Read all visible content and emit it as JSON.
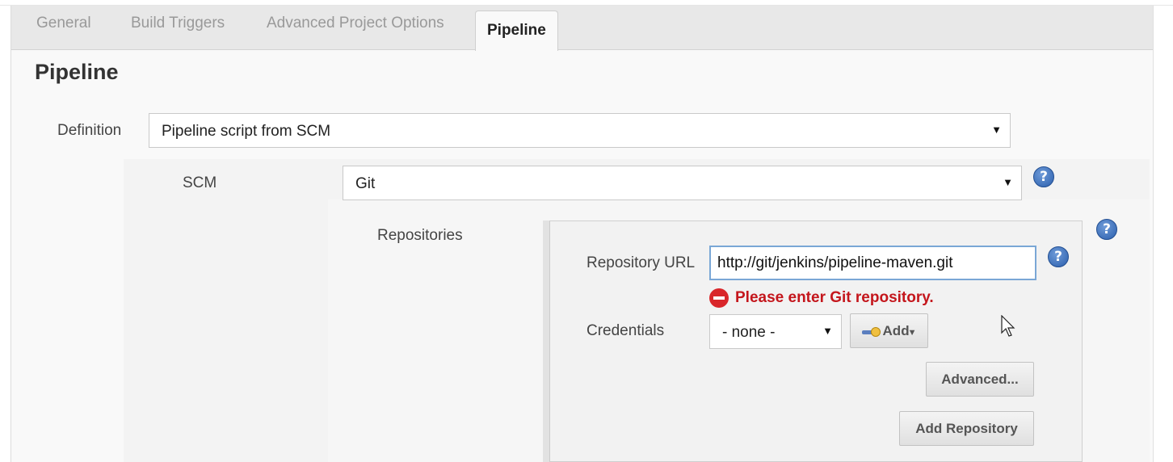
{
  "tabs": [
    {
      "label": "General",
      "active": false
    },
    {
      "label": "Build Triggers",
      "active": false
    },
    {
      "label": "Advanced Project Options",
      "active": false
    },
    {
      "label": "Pipeline",
      "active": true
    }
  ],
  "section": {
    "title": "Pipeline"
  },
  "definition": {
    "label": "Definition",
    "value": "Pipeline script from SCM"
  },
  "scm": {
    "label": "SCM",
    "value": "Git"
  },
  "repositories": {
    "label": "Repositories",
    "repository_url": {
      "label": "Repository URL",
      "value": "http://git/jenkins/pipeline-maven.git",
      "error": "Please enter Git repository."
    },
    "credentials": {
      "label": "Credentials",
      "value": "- none -",
      "add_label": "Add"
    },
    "advanced_label": "Advanced...",
    "add_repository_label": "Add Repository"
  },
  "help_icon_glyph": "?",
  "dropdown_arrow_glyph": "▼",
  "colors": {
    "error": "#c4161c",
    "help": "#2b5fad",
    "input_focus": "#7aa7d6"
  }
}
